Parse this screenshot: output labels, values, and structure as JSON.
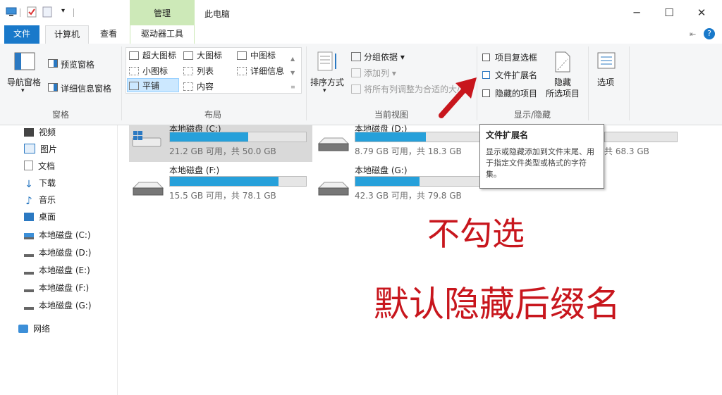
{
  "window": {
    "title": "此电脑",
    "context_tab_header": "管理",
    "controls": {
      "minimize": "─",
      "maximize": "☐",
      "close": "✕"
    }
  },
  "tabs": {
    "file": "文件",
    "computer": "计算机",
    "view": "查看",
    "drive_tools": "驱动器工具"
  },
  "ribbon": {
    "panes": {
      "nav_pane": "导航窗格",
      "preview_pane": "预览窗格",
      "details_pane": "详细信息窗格",
      "group_label": "窗格"
    },
    "layout": {
      "extra_large": "超大图标",
      "large": "大图标",
      "medium": "中图标",
      "small": "小图标",
      "list": "列表",
      "details": "详细信息",
      "tiles": "平铺",
      "content": "内容",
      "group_label": "布局"
    },
    "current_view": {
      "sort_by": "排序方式",
      "group_by": "分组依据",
      "add_column": "添加列",
      "fit_columns": "将所有列调整为合适的大小",
      "group_label": "当前视图"
    },
    "show_hide": {
      "item_checkboxes": "项目复选框",
      "file_extensions": "文件扩展名",
      "hidden_items": "隐藏的项目",
      "hide_label": "隐藏",
      "selected_items": "所选项目",
      "group_label": "显示/隐藏"
    },
    "options": "选项"
  },
  "nav_pane": {
    "items": [
      "视频",
      "图片",
      "文档",
      "下载",
      "音乐",
      "桌面",
      "本地磁盘 (C:)",
      "本地磁盘 (D:)",
      "本地磁盘 (E:)",
      "本地磁盘 (F:)",
      "本地磁盘 (G:)",
      "网络"
    ]
  },
  "drives": [
    {
      "name": "本地磁盘 (C:)",
      "info": "21.2 GB 可用，共 50.0 GB",
      "used_fraction": 0.576
    },
    {
      "name": "本地磁盘 (D:)",
      "info": "8.79 GB 可用，共 18.3 GB",
      "used_fraction": 0.52
    },
    {
      "name": "本地磁盘 (F:)",
      "info": "15.5 GB 可用，共 78.1 GB",
      "used_fraction": 0.8
    },
    {
      "name": "本地磁盘 (G:)",
      "info": "42.3 GB 可用，共 79.8 GB",
      "used_fraction": 0.47
    }
  ],
  "partial_drive_info": "共 68.3 GB",
  "tooltip": {
    "title": "文件扩展名",
    "body": "显示或隐藏添加到文件末尾、用于指定文件类型或格式的字符集。"
  },
  "annotations": {
    "line1": "不勾选",
    "line2": "默认隐藏后缀名"
  },
  "colors": {
    "accent": "#1979ca",
    "context_tab": "#cde9b8",
    "drive_fill": "#26a0da",
    "annotation": "#c8161d"
  }
}
